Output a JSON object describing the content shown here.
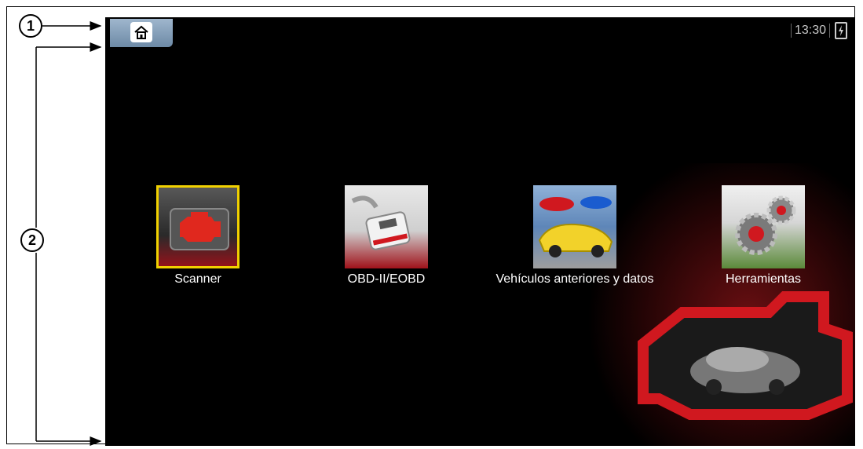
{
  "callouts": {
    "c1": "1",
    "c2": "2"
  },
  "status": {
    "time": "13:30"
  },
  "apps": [
    {
      "label": "Scanner",
      "icon": "engine-check-icon"
    },
    {
      "label": "OBD-II/EOBD",
      "icon": "obd-connector-icon"
    },
    {
      "label": "Vehículos anteriores y datos",
      "icon": "cars-icon"
    },
    {
      "label": "Herramientas",
      "icon": "gears-icon"
    }
  ],
  "colors": {
    "selection": "#f1d100",
    "accent_red": "#c4161c",
    "background": "#000000"
  }
}
